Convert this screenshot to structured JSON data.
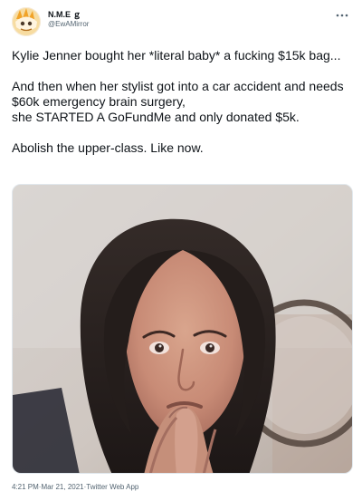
{
  "tweet": {
    "author": {
      "display_name": "N.M.E ｇ",
      "handle": "@EwAMirror",
      "avatar_icon": "avatar-icon"
    },
    "actions": {
      "more_icon": "more-horizontal-icon"
    },
    "text": "Kylie Jenner bought her *literal baby* a fucking $15k bag...\n\nAnd then when her stylist got into a car accident and needs $60k emergency brain surgery,\nshe STARTED A GoFundMe and only donated $5k.\n\nAbolish the upper-class. Like now.",
    "timestamp": {
      "time": "4:21 PM",
      "separator_1": " · ",
      "date": "Mar 21, 2021",
      "separator_2": " · ",
      "client": "Twitter Web App"
    }
  },
  "colors": {
    "text_primary": "#0f1419",
    "text_secondary": "#536471",
    "border": "#e1e8ed",
    "background": "#ffffff"
  }
}
